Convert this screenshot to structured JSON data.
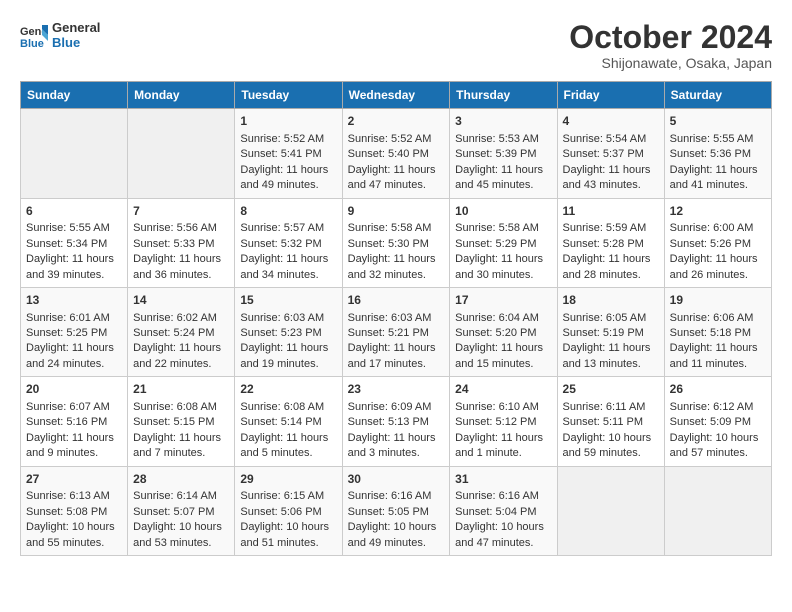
{
  "header": {
    "logo_line1": "General",
    "logo_line2": "Blue",
    "month": "October 2024",
    "location": "Shijonawate, Osaka, Japan"
  },
  "weekdays": [
    "Sunday",
    "Monday",
    "Tuesday",
    "Wednesday",
    "Thursday",
    "Friday",
    "Saturday"
  ],
  "weeks": [
    [
      {
        "day": "",
        "empty": true
      },
      {
        "day": "",
        "empty": true
      },
      {
        "day": "1",
        "sunrise": "Sunrise: 5:52 AM",
        "sunset": "Sunset: 5:41 PM",
        "daylight": "Daylight: 11 hours and 49 minutes."
      },
      {
        "day": "2",
        "sunrise": "Sunrise: 5:52 AM",
        "sunset": "Sunset: 5:40 PM",
        "daylight": "Daylight: 11 hours and 47 minutes."
      },
      {
        "day": "3",
        "sunrise": "Sunrise: 5:53 AM",
        "sunset": "Sunset: 5:39 PM",
        "daylight": "Daylight: 11 hours and 45 minutes."
      },
      {
        "day": "4",
        "sunrise": "Sunrise: 5:54 AM",
        "sunset": "Sunset: 5:37 PM",
        "daylight": "Daylight: 11 hours and 43 minutes."
      },
      {
        "day": "5",
        "sunrise": "Sunrise: 5:55 AM",
        "sunset": "Sunset: 5:36 PM",
        "daylight": "Daylight: 11 hours and 41 minutes."
      }
    ],
    [
      {
        "day": "6",
        "sunrise": "Sunrise: 5:55 AM",
        "sunset": "Sunset: 5:34 PM",
        "daylight": "Daylight: 11 hours and 39 minutes."
      },
      {
        "day": "7",
        "sunrise": "Sunrise: 5:56 AM",
        "sunset": "Sunset: 5:33 PM",
        "daylight": "Daylight: 11 hours and 36 minutes."
      },
      {
        "day": "8",
        "sunrise": "Sunrise: 5:57 AM",
        "sunset": "Sunset: 5:32 PM",
        "daylight": "Daylight: 11 hours and 34 minutes."
      },
      {
        "day": "9",
        "sunrise": "Sunrise: 5:58 AM",
        "sunset": "Sunset: 5:30 PM",
        "daylight": "Daylight: 11 hours and 32 minutes."
      },
      {
        "day": "10",
        "sunrise": "Sunrise: 5:58 AM",
        "sunset": "Sunset: 5:29 PM",
        "daylight": "Daylight: 11 hours and 30 minutes."
      },
      {
        "day": "11",
        "sunrise": "Sunrise: 5:59 AM",
        "sunset": "Sunset: 5:28 PM",
        "daylight": "Daylight: 11 hours and 28 minutes."
      },
      {
        "day": "12",
        "sunrise": "Sunrise: 6:00 AM",
        "sunset": "Sunset: 5:26 PM",
        "daylight": "Daylight: 11 hours and 26 minutes."
      }
    ],
    [
      {
        "day": "13",
        "sunrise": "Sunrise: 6:01 AM",
        "sunset": "Sunset: 5:25 PM",
        "daylight": "Daylight: 11 hours and 24 minutes."
      },
      {
        "day": "14",
        "sunrise": "Sunrise: 6:02 AM",
        "sunset": "Sunset: 5:24 PM",
        "daylight": "Daylight: 11 hours and 22 minutes."
      },
      {
        "day": "15",
        "sunrise": "Sunrise: 6:03 AM",
        "sunset": "Sunset: 5:23 PM",
        "daylight": "Daylight: 11 hours and 19 minutes."
      },
      {
        "day": "16",
        "sunrise": "Sunrise: 6:03 AM",
        "sunset": "Sunset: 5:21 PM",
        "daylight": "Daylight: 11 hours and 17 minutes."
      },
      {
        "day": "17",
        "sunrise": "Sunrise: 6:04 AM",
        "sunset": "Sunset: 5:20 PM",
        "daylight": "Daylight: 11 hours and 15 minutes."
      },
      {
        "day": "18",
        "sunrise": "Sunrise: 6:05 AM",
        "sunset": "Sunset: 5:19 PM",
        "daylight": "Daylight: 11 hours and 13 minutes."
      },
      {
        "day": "19",
        "sunrise": "Sunrise: 6:06 AM",
        "sunset": "Sunset: 5:18 PM",
        "daylight": "Daylight: 11 hours and 11 minutes."
      }
    ],
    [
      {
        "day": "20",
        "sunrise": "Sunrise: 6:07 AM",
        "sunset": "Sunset: 5:16 PM",
        "daylight": "Daylight: 11 hours and 9 minutes."
      },
      {
        "day": "21",
        "sunrise": "Sunrise: 6:08 AM",
        "sunset": "Sunset: 5:15 PM",
        "daylight": "Daylight: 11 hours and 7 minutes."
      },
      {
        "day": "22",
        "sunrise": "Sunrise: 6:08 AM",
        "sunset": "Sunset: 5:14 PM",
        "daylight": "Daylight: 11 hours and 5 minutes."
      },
      {
        "day": "23",
        "sunrise": "Sunrise: 6:09 AM",
        "sunset": "Sunset: 5:13 PM",
        "daylight": "Daylight: 11 hours and 3 minutes."
      },
      {
        "day": "24",
        "sunrise": "Sunrise: 6:10 AM",
        "sunset": "Sunset: 5:12 PM",
        "daylight": "Daylight: 11 hours and 1 minute."
      },
      {
        "day": "25",
        "sunrise": "Sunrise: 6:11 AM",
        "sunset": "Sunset: 5:11 PM",
        "daylight": "Daylight: 10 hours and 59 minutes."
      },
      {
        "day": "26",
        "sunrise": "Sunrise: 6:12 AM",
        "sunset": "Sunset: 5:09 PM",
        "daylight": "Daylight: 10 hours and 57 minutes."
      }
    ],
    [
      {
        "day": "27",
        "sunrise": "Sunrise: 6:13 AM",
        "sunset": "Sunset: 5:08 PM",
        "daylight": "Daylight: 10 hours and 55 minutes."
      },
      {
        "day": "28",
        "sunrise": "Sunrise: 6:14 AM",
        "sunset": "Sunset: 5:07 PM",
        "daylight": "Daylight: 10 hours and 53 minutes."
      },
      {
        "day": "29",
        "sunrise": "Sunrise: 6:15 AM",
        "sunset": "Sunset: 5:06 PM",
        "daylight": "Daylight: 10 hours and 51 minutes."
      },
      {
        "day": "30",
        "sunrise": "Sunrise: 6:16 AM",
        "sunset": "Sunset: 5:05 PM",
        "daylight": "Daylight: 10 hours and 49 minutes."
      },
      {
        "day": "31",
        "sunrise": "Sunrise: 6:16 AM",
        "sunset": "Sunset: 5:04 PM",
        "daylight": "Daylight: 10 hours and 47 minutes."
      },
      {
        "day": "",
        "empty": true
      },
      {
        "day": "",
        "empty": true
      }
    ]
  ]
}
